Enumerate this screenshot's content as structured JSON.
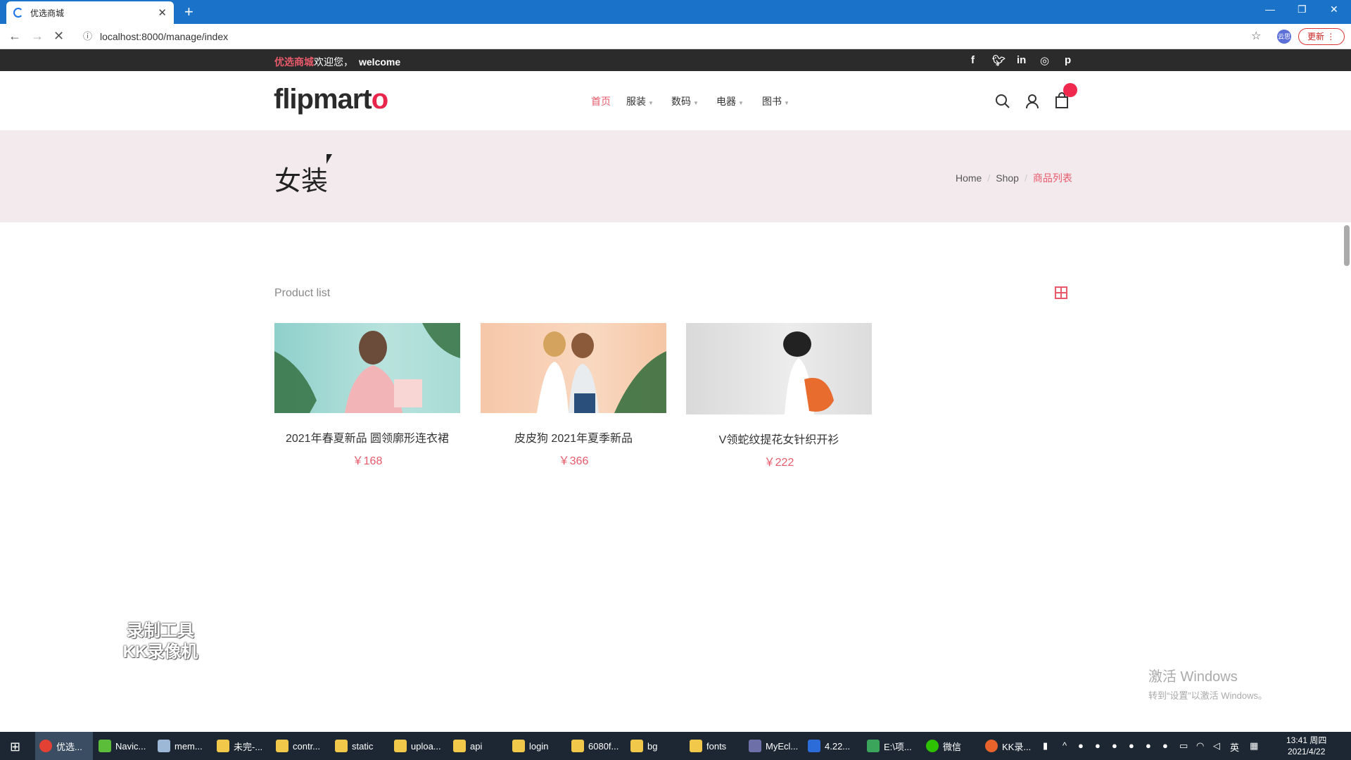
{
  "browser": {
    "tab_title": "优选商城",
    "url": "localhost:8000/manage/index",
    "ext_label": "云思",
    "update_label": "更新"
  },
  "topbar": {
    "brand": "优选商城",
    "greeting": "欢迎您，",
    "welcome": "welcome",
    "social": [
      "f",
      "t",
      "in",
      "ig",
      "p"
    ]
  },
  "header": {
    "logo_main": "flipmart",
    "logo_o": "o",
    "menu": [
      {
        "label": "首页",
        "active": true
      },
      {
        "label": "服装"
      },
      {
        "label": "数码"
      },
      {
        "label": "电器"
      },
      {
        "label": "图书"
      }
    ]
  },
  "banner": {
    "title": "女装",
    "breadcrumb": [
      "Home",
      "Shop",
      "商品列表"
    ]
  },
  "content": {
    "heading": "Product list",
    "products": [
      {
        "name": "2021年春夏新品 圆领廓形连衣裙",
        "price": "￥168"
      },
      {
        "name": "皮皮狗 2021年夏季新品",
        "price": "￥366"
      },
      {
        "name": "V领蛇纹提花女针织开衫",
        "price": "￥222"
      }
    ]
  },
  "overlay": {
    "watermark_line1": "录制工具",
    "watermark_line2": "KK录像机",
    "activate_line1": "激活 Windows",
    "activate_line2": "转到“设置”以激活 Windows。"
  },
  "taskbar": {
    "items": [
      "优选...",
      "Navic...",
      "mem...",
      "未完-...",
      "contr...",
      "static",
      "uploa...",
      "api",
      "login",
      "6080f...",
      "bg",
      "fonts",
      "MyEcl...",
      "4.22...",
      "E:\\项...",
      "微信",
      "KK录..."
    ],
    "ime": "英",
    "time": "13:41 周四",
    "date": "2021/4/22"
  }
}
